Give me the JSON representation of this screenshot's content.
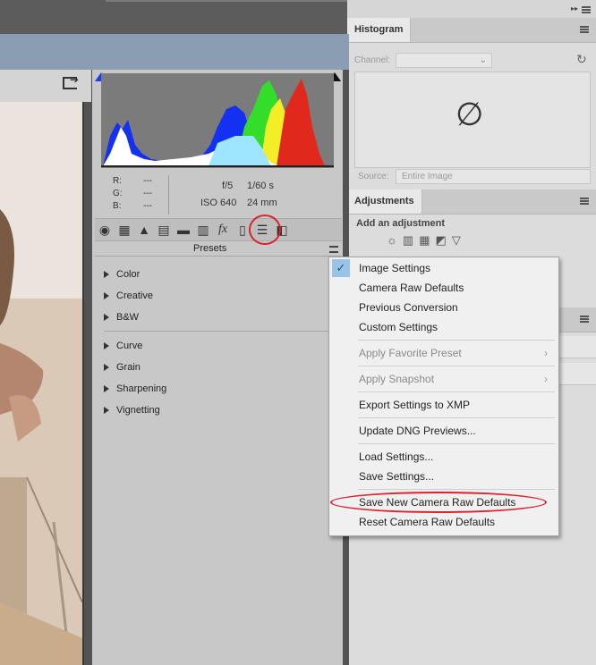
{
  "histogram_panel": {
    "tab": "Histogram",
    "channel_label": "Channel:",
    "source_label": "Source:",
    "source_value": "Entire Image",
    "empty_symbol": "∅"
  },
  "adjustments_panel": {
    "tab": "Adjustments",
    "prompt": "Add an adjustment"
  },
  "camera_raw": {
    "readout": {
      "r_label": "R:",
      "r_value": "---",
      "g_label": "G:",
      "g_value": "---",
      "b_label": "B:",
      "b_value": "---",
      "aperture": "f/5",
      "shutter": "1/60 s",
      "iso": "ISO 640",
      "focal": "24 mm"
    },
    "presets_title": "Presets",
    "presets_group1": [
      "Color",
      "Creative",
      "B&W"
    ],
    "presets_group2": [
      "Curve",
      "Grain",
      "Sharpening",
      "Vignetting"
    ]
  },
  "menu": {
    "checked_item": "Image Settings",
    "group1": [
      "Camera Raw Defaults",
      "Previous Conversion",
      "Custom Settings"
    ],
    "apply_favorite": "Apply Favorite Preset",
    "apply_snapshot": "Apply Snapshot",
    "export_xmp": "Export Settings to XMP",
    "update_dng": "Update DNG Previews...",
    "load": "Load Settings...",
    "save": "Save Settings...",
    "save_new_defaults": "Save New Camera Raw Defaults",
    "reset_defaults": "Reset Camera Raw Defaults"
  },
  "colors": {
    "annotation_red": "#d9232f",
    "menu_check_bg": "#99c4e8"
  }
}
